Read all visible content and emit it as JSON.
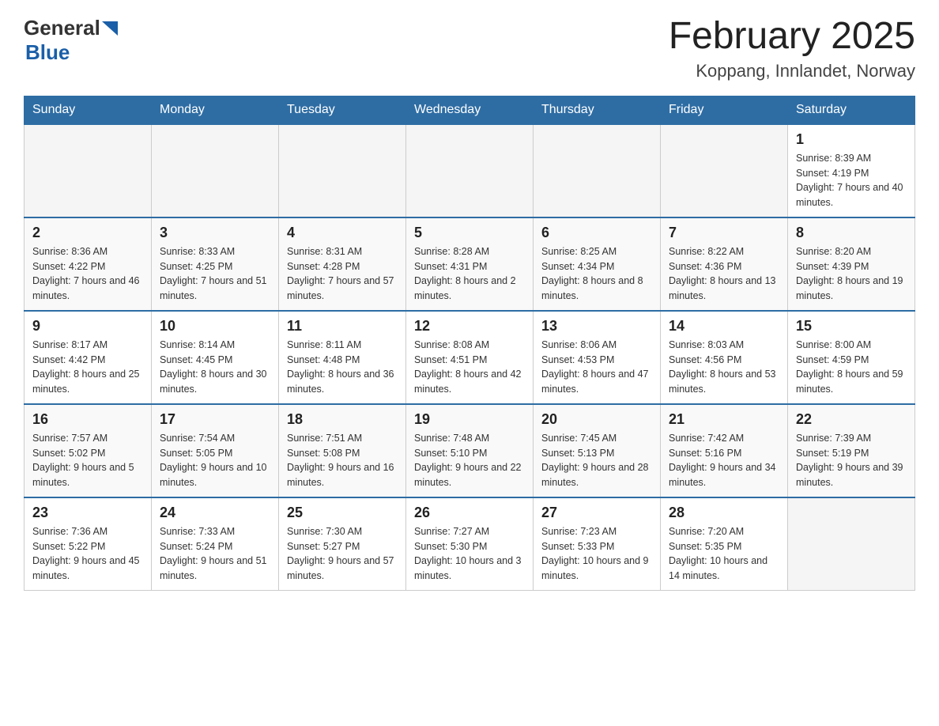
{
  "header": {
    "logo": {
      "text_general": "General",
      "text_blue": "Blue"
    },
    "title": "February 2025",
    "location": "Koppang, Innlandet, Norway"
  },
  "days_of_week": [
    "Sunday",
    "Monday",
    "Tuesday",
    "Wednesday",
    "Thursday",
    "Friday",
    "Saturday"
  ],
  "weeks": [
    [
      {
        "day": "",
        "info": ""
      },
      {
        "day": "",
        "info": ""
      },
      {
        "day": "",
        "info": ""
      },
      {
        "day": "",
        "info": ""
      },
      {
        "day": "",
        "info": ""
      },
      {
        "day": "",
        "info": ""
      },
      {
        "day": "1",
        "info": "Sunrise: 8:39 AM\nSunset: 4:19 PM\nDaylight: 7 hours and 40 minutes."
      }
    ],
    [
      {
        "day": "2",
        "info": "Sunrise: 8:36 AM\nSunset: 4:22 PM\nDaylight: 7 hours and 46 minutes."
      },
      {
        "day": "3",
        "info": "Sunrise: 8:33 AM\nSunset: 4:25 PM\nDaylight: 7 hours and 51 minutes."
      },
      {
        "day": "4",
        "info": "Sunrise: 8:31 AM\nSunset: 4:28 PM\nDaylight: 7 hours and 57 minutes."
      },
      {
        "day": "5",
        "info": "Sunrise: 8:28 AM\nSunset: 4:31 PM\nDaylight: 8 hours and 2 minutes."
      },
      {
        "day": "6",
        "info": "Sunrise: 8:25 AM\nSunset: 4:34 PM\nDaylight: 8 hours and 8 minutes."
      },
      {
        "day": "7",
        "info": "Sunrise: 8:22 AM\nSunset: 4:36 PM\nDaylight: 8 hours and 13 minutes."
      },
      {
        "day": "8",
        "info": "Sunrise: 8:20 AM\nSunset: 4:39 PM\nDaylight: 8 hours and 19 minutes."
      }
    ],
    [
      {
        "day": "9",
        "info": "Sunrise: 8:17 AM\nSunset: 4:42 PM\nDaylight: 8 hours and 25 minutes."
      },
      {
        "day": "10",
        "info": "Sunrise: 8:14 AM\nSunset: 4:45 PM\nDaylight: 8 hours and 30 minutes."
      },
      {
        "day": "11",
        "info": "Sunrise: 8:11 AM\nSunset: 4:48 PM\nDaylight: 8 hours and 36 minutes."
      },
      {
        "day": "12",
        "info": "Sunrise: 8:08 AM\nSunset: 4:51 PM\nDaylight: 8 hours and 42 minutes."
      },
      {
        "day": "13",
        "info": "Sunrise: 8:06 AM\nSunset: 4:53 PM\nDaylight: 8 hours and 47 minutes."
      },
      {
        "day": "14",
        "info": "Sunrise: 8:03 AM\nSunset: 4:56 PM\nDaylight: 8 hours and 53 minutes."
      },
      {
        "day": "15",
        "info": "Sunrise: 8:00 AM\nSunset: 4:59 PM\nDaylight: 8 hours and 59 minutes."
      }
    ],
    [
      {
        "day": "16",
        "info": "Sunrise: 7:57 AM\nSunset: 5:02 PM\nDaylight: 9 hours and 5 minutes."
      },
      {
        "day": "17",
        "info": "Sunrise: 7:54 AM\nSunset: 5:05 PM\nDaylight: 9 hours and 10 minutes."
      },
      {
        "day": "18",
        "info": "Sunrise: 7:51 AM\nSunset: 5:08 PM\nDaylight: 9 hours and 16 minutes."
      },
      {
        "day": "19",
        "info": "Sunrise: 7:48 AM\nSunset: 5:10 PM\nDaylight: 9 hours and 22 minutes."
      },
      {
        "day": "20",
        "info": "Sunrise: 7:45 AM\nSunset: 5:13 PM\nDaylight: 9 hours and 28 minutes."
      },
      {
        "day": "21",
        "info": "Sunrise: 7:42 AM\nSunset: 5:16 PM\nDaylight: 9 hours and 34 minutes."
      },
      {
        "day": "22",
        "info": "Sunrise: 7:39 AM\nSunset: 5:19 PM\nDaylight: 9 hours and 39 minutes."
      }
    ],
    [
      {
        "day": "23",
        "info": "Sunrise: 7:36 AM\nSunset: 5:22 PM\nDaylight: 9 hours and 45 minutes."
      },
      {
        "day": "24",
        "info": "Sunrise: 7:33 AM\nSunset: 5:24 PM\nDaylight: 9 hours and 51 minutes."
      },
      {
        "day": "25",
        "info": "Sunrise: 7:30 AM\nSunset: 5:27 PM\nDaylight: 9 hours and 57 minutes."
      },
      {
        "day": "26",
        "info": "Sunrise: 7:27 AM\nSunset: 5:30 PM\nDaylight: 10 hours and 3 minutes."
      },
      {
        "day": "27",
        "info": "Sunrise: 7:23 AM\nSunset: 5:33 PM\nDaylight: 10 hours and 9 minutes."
      },
      {
        "day": "28",
        "info": "Sunrise: 7:20 AM\nSunset: 5:35 PM\nDaylight: 10 hours and 14 minutes."
      },
      {
        "day": "",
        "info": ""
      }
    ]
  ]
}
